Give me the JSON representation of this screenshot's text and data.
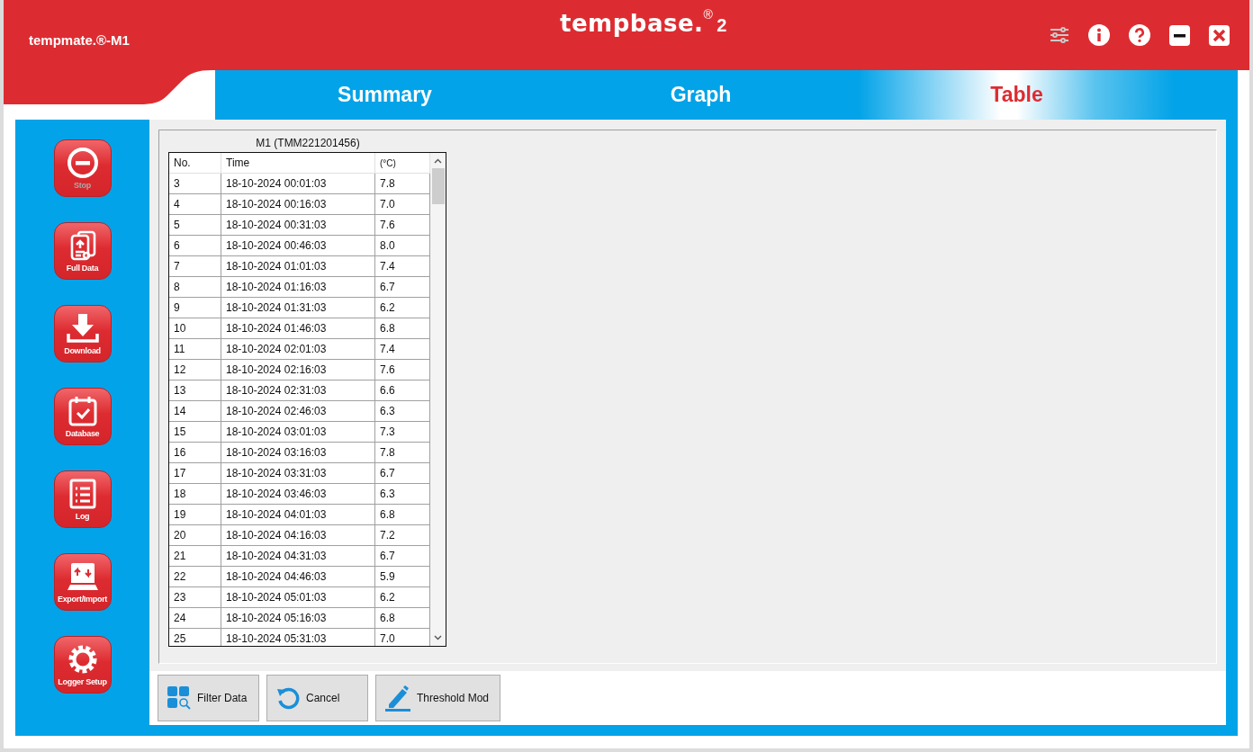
{
  "window": {
    "device": "tempmate.®-M1",
    "logo": "tempbase.",
    "logo_mark": "®",
    "logo_version": "2"
  },
  "tabs": [
    {
      "label": "Summary",
      "selected": false
    },
    {
      "label": "Graph",
      "selected": false
    },
    {
      "label": "Table",
      "selected": true
    }
  ],
  "sidebar": {
    "items": [
      {
        "kind": "stop",
        "label": "Stop",
        "disabled": true
      },
      {
        "kind": "fulldata",
        "label": "Full Data",
        "disabled": false
      },
      {
        "kind": "download",
        "label": "Download",
        "disabled": false
      },
      {
        "kind": "database",
        "label": "Database",
        "disabled": false
      },
      {
        "kind": "log",
        "label": "Log",
        "disabled": false
      },
      {
        "kind": "export",
        "label": "Export/Import",
        "disabled": false
      },
      {
        "kind": "setup",
        "label": "Logger Setup",
        "disabled": false
      }
    ]
  },
  "table": {
    "title": "M1 (TMM221201456)",
    "columns": [
      "No.",
      "Time",
      "(°C)"
    ],
    "rows": [
      [
        "3",
        "18-10-2024 00:01:03",
        "7.8"
      ],
      [
        "4",
        "18-10-2024 00:16:03",
        "7.0"
      ],
      [
        "5",
        "18-10-2024 00:31:03",
        "7.6"
      ],
      [
        "6",
        "18-10-2024 00:46:03",
        "8.0"
      ],
      [
        "7",
        "18-10-2024 01:01:03",
        "7.4"
      ],
      [
        "8",
        "18-10-2024 01:16:03",
        "6.7"
      ],
      [
        "9",
        "18-10-2024 01:31:03",
        "6.2"
      ],
      [
        "10",
        "18-10-2024 01:46:03",
        "6.8"
      ],
      [
        "11",
        "18-10-2024 02:01:03",
        "7.4"
      ],
      [
        "12",
        "18-10-2024 02:16:03",
        "7.6"
      ],
      [
        "13",
        "18-10-2024 02:31:03",
        "6.6"
      ],
      [
        "14",
        "18-10-2024 02:46:03",
        "6.3"
      ],
      [
        "15",
        "18-10-2024 03:01:03",
        "7.3"
      ],
      [
        "16",
        "18-10-2024 03:16:03",
        "7.8"
      ],
      [
        "17",
        "18-10-2024 03:31:03",
        "6.7"
      ],
      [
        "18",
        "18-10-2024 03:46:03",
        "6.3"
      ],
      [
        "19",
        "18-10-2024 04:01:03",
        "6.8"
      ],
      [
        "20",
        "18-10-2024 04:16:03",
        "7.2"
      ],
      [
        "21",
        "18-10-2024 04:31:03",
        "6.7"
      ],
      [
        "22",
        "18-10-2024 04:46:03",
        "5.9"
      ],
      [
        "23",
        "18-10-2024 05:01:03",
        "6.2"
      ],
      [
        "24",
        "18-10-2024 05:16:03",
        "6.8"
      ],
      [
        "25",
        "18-10-2024 05:31:03",
        "7.0"
      ]
    ]
  },
  "buttons": [
    {
      "kind": "filter",
      "label": "Filter Data"
    },
    {
      "kind": "cancel",
      "label": "Cancel"
    },
    {
      "kind": "edit",
      "label": "Threshold Mod"
    }
  ]
}
